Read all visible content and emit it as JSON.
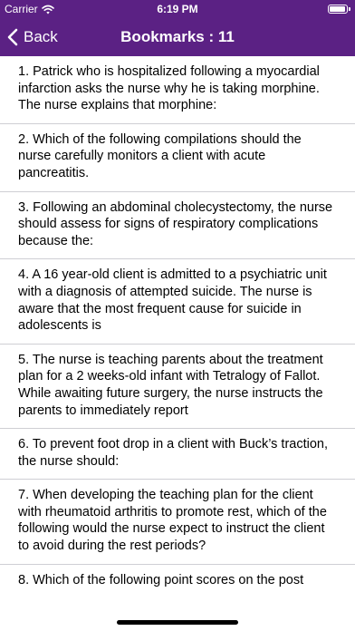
{
  "status_bar": {
    "carrier": "Carrier",
    "time": "6:19 PM"
  },
  "nav": {
    "back_label": "Back",
    "title": "Bookmarks : 11"
  },
  "colors": {
    "header": "#5b2184",
    "separator": "#cfcfd4"
  },
  "bookmarks": [
    "1. Patrick who is hospitalized following a myocardial infarction asks the nurse why he is taking morphine. The nurse explains that morphine:",
    "2. Which of the following compilations should the nurse carefully monitors a client with acute pancreatitis.",
    "3. Following an abdominal cholecystectomy, the nurse should assess for signs of respiratory complications because the:",
    "4. A 16 year-old client is admitted to a psychiatric unit with a diagnosis of attempted suicide. The nurse is aware that the most frequent cause for suicide in adolescents is",
    "5. The nurse is teaching parents about the treatment plan for a 2 weeks-old infant with Tetralogy of Fallot. While awaiting future surgery, the nurse instructs the parents to immediately report",
    "6. To prevent foot drop in a client with Buck’s traction, the nurse should:",
    "7. When developing the teaching plan for the client with rheumatoid arthritis to promote rest, which of the following would the nurse expect to instruct the client to avoid during the rest periods?",
    "8. Which of the following point scores on the post"
  ]
}
